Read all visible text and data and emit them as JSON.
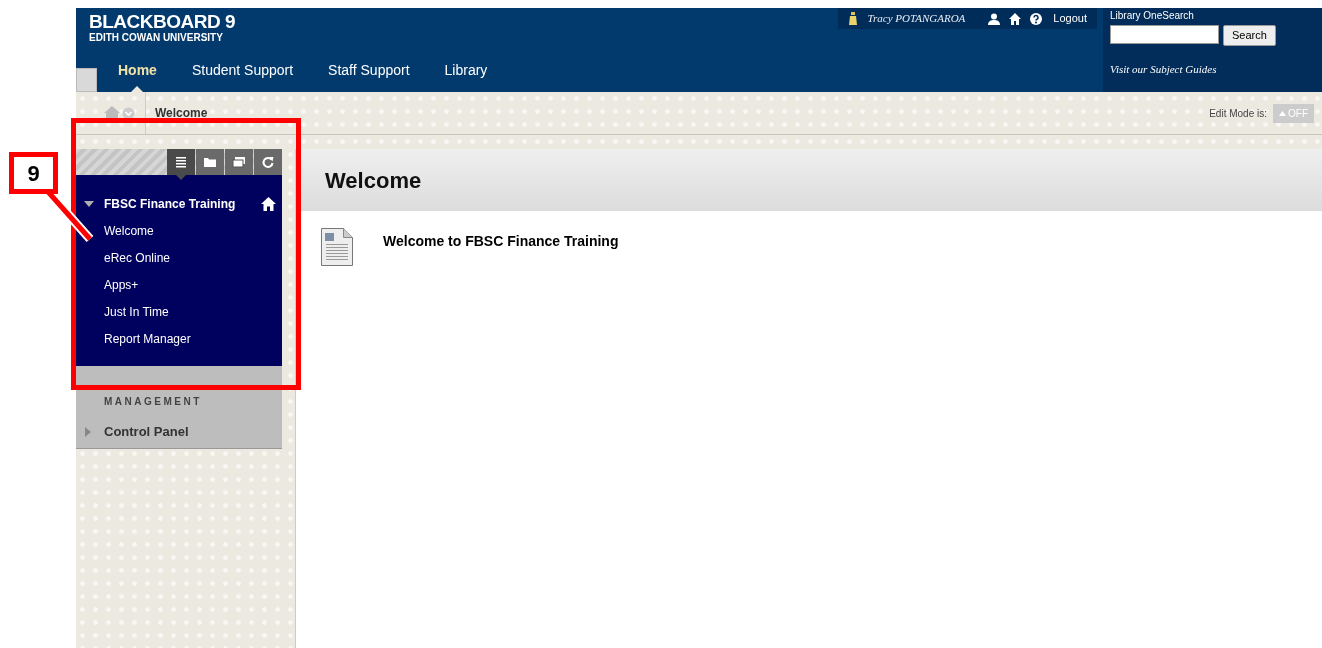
{
  "header": {
    "brand": "BLACKBOARD 9",
    "subtitle": "EDITH COWAN UNIVERSITY",
    "user": "Tracy POTANGAROA",
    "logout": "Logout",
    "nav": [
      {
        "label": "Home",
        "selected": true
      },
      {
        "label": "Student Support",
        "selected": false
      },
      {
        "label": "Staff Support",
        "selected": false
      },
      {
        "label": "Library",
        "selected": false
      }
    ],
    "library": {
      "label": "Library OneSearch",
      "button": "Search",
      "link": "Visit our Subject Guides"
    }
  },
  "breadcrumb": {
    "current": "Welcome",
    "edit_mode_label": "Edit Mode is:",
    "edit_mode": "OFF"
  },
  "sidebar": {
    "tabs": [
      {
        "kind": "list",
        "selected": true
      },
      {
        "kind": "folder",
        "selected": false
      },
      {
        "kind": "windows",
        "selected": false
      },
      {
        "kind": "refresh",
        "selected": false
      }
    ],
    "course": {
      "title": "FBSC Finance Training",
      "expanded": true,
      "items": [
        "Welcome",
        "eRec Online",
        "Apps+",
        "Just In Time",
        "Report Manager"
      ]
    },
    "section": {
      "heading": "MANAGEMENT",
      "items": [
        {
          "label": "Control Panel",
          "expanded": false
        }
      ]
    }
  },
  "content": {
    "title": "Welcome",
    "items": [
      {
        "kind": "document",
        "title": "Welcome to FBSC Finance Training"
      }
    ]
  },
  "callout": {
    "number": "9"
  }
}
